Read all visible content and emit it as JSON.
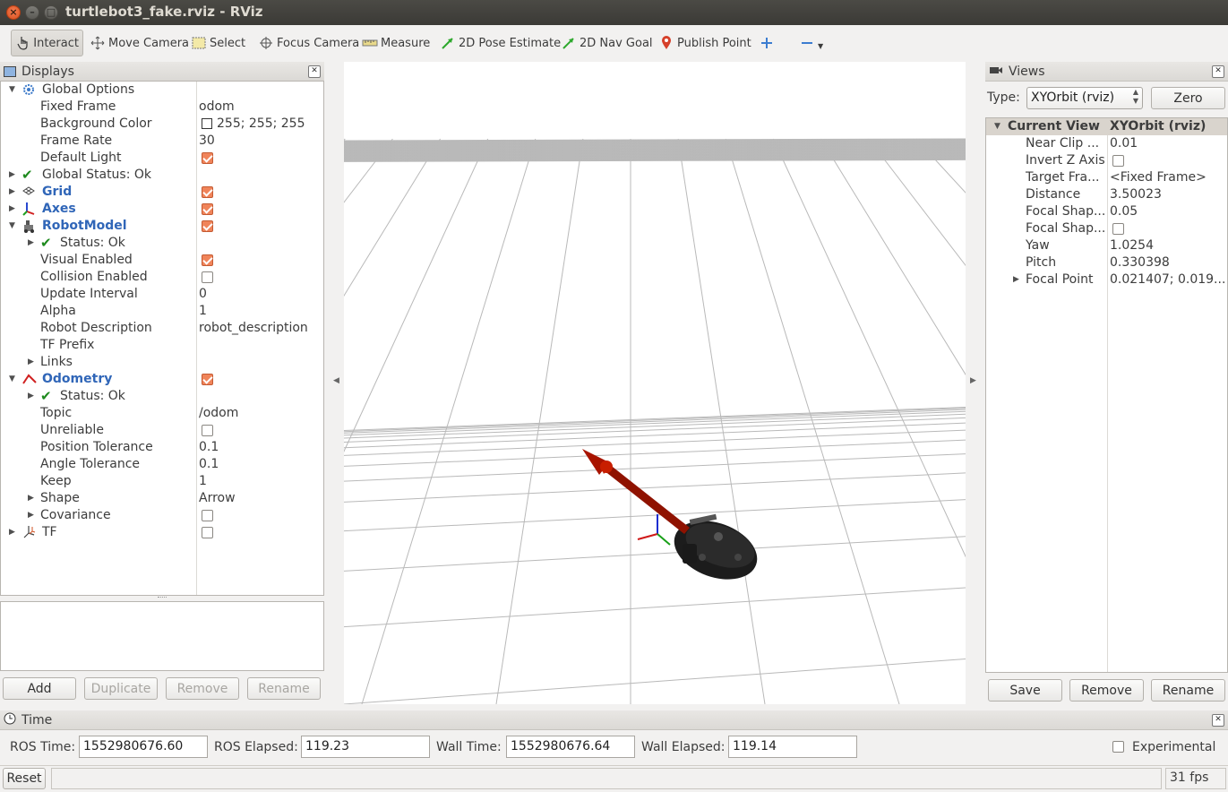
{
  "window": {
    "title": "turtlebot3_fake.rviz - RViz"
  },
  "toolbar": {
    "interact": "Interact",
    "move_camera": "Move Camera",
    "select": "Select",
    "focus_camera": "Focus Camera",
    "measure": "Measure",
    "pose_estimate": "2D Pose Estimate",
    "nav_goal": "2D Nav Goal",
    "publish_point": "Publish Point"
  },
  "displays": {
    "title": "Displays",
    "rows": {
      "global_options": "Global Options",
      "fixed_frame": "Fixed Frame",
      "fixed_frame_val": "odom",
      "bg_color": "Background Color",
      "bg_color_val": "255; 255; 255",
      "frame_rate": "Frame Rate",
      "frame_rate_val": "30",
      "default_light": "Default Light",
      "global_status": "Global Status: Ok",
      "grid": "Grid",
      "axes": "Axes",
      "robot_model": "RobotModel",
      "rm_status": "Status: Ok",
      "visual_enabled": "Visual Enabled",
      "collision_enabled": "Collision Enabled",
      "update_interval": "Update Interval",
      "update_interval_val": "0",
      "alpha": "Alpha",
      "alpha_val": "1",
      "robot_description": "Robot Description",
      "robot_description_val": "robot_description",
      "tf_prefix": "TF Prefix",
      "links": "Links",
      "odometry": "Odometry",
      "odom_status": "Status: Ok",
      "topic": "Topic",
      "topic_val": "/odom",
      "unreliable": "Unreliable",
      "pos_tol": "Position Tolerance",
      "pos_tol_val": "0.1",
      "ang_tol": "Angle Tolerance",
      "ang_tol_val": "0.1",
      "keep": "Keep",
      "keep_val": "1",
      "shape": "Shape",
      "shape_val": "Arrow",
      "covariance": "Covariance",
      "tf": "TF"
    },
    "buttons": {
      "add": "Add",
      "duplicate": "Duplicate",
      "remove": "Remove",
      "rename": "Rename"
    }
  },
  "views": {
    "title": "Views",
    "type_label": "Type:",
    "type_value": "XYOrbit (rviz)",
    "zero": "Zero",
    "current_view": "Current View",
    "current_view_val": "XYOrbit (rviz)",
    "near_clip": "Near Clip ...",
    "near_clip_val": "0.01",
    "invert_z": "Invert Z Axis",
    "target_frame": "Target Fra...",
    "target_frame_val": "<Fixed Frame>",
    "distance": "Distance",
    "distance_val": "3.50023",
    "focal_shape1": "Focal Shap...",
    "focal_shape1_val": "0.05",
    "focal_shape2": "Focal Shap...",
    "yaw": "Yaw",
    "yaw_val": "1.0254",
    "pitch": "Pitch",
    "pitch_val": "0.330398",
    "focal_point": "Focal Point",
    "focal_point_val": "0.021407; 0.019...",
    "buttons": {
      "save": "Save",
      "remove": "Remove",
      "rename": "Rename"
    }
  },
  "time": {
    "title": "Time",
    "ros_time_label": "ROS Time:",
    "ros_time": "1552980676.60",
    "ros_elapsed_label": "ROS Elapsed:",
    "ros_elapsed": "119.23",
    "wall_time_label": "Wall Time:",
    "wall_time": "1552980676.64",
    "wall_elapsed_label": "Wall Elapsed:",
    "wall_elapsed": "119.14",
    "experimental": "Experimental"
  },
  "status": {
    "reset": "Reset",
    "fps": "31 fps"
  },
  "colors": {
    "accent": "#3066b8",
    "checkbox": "#f0845a",
    "arrow": "#b01800",
    "titlebar": "#3c3b37"
  }
}
